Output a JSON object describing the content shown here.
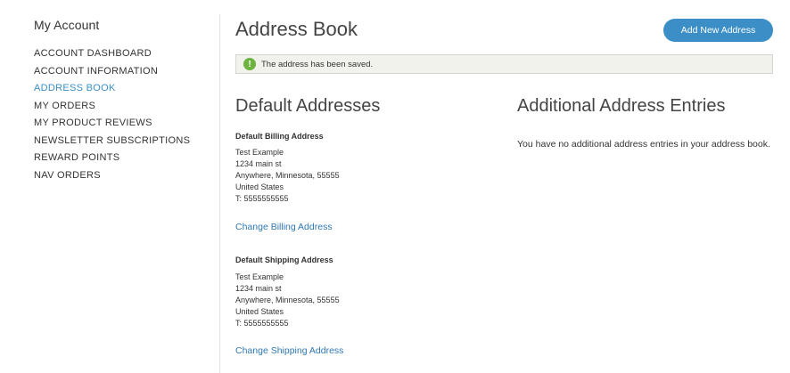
{
  "sidebar": {
    "title": "My Account",
    "items": [
      {
        "label": "ACCOUNT DASHBOARD"
      },
      {
        "label": "ACCOUNT INFORMATION"
      },
      {
        "label": "ADDRESS BOOK"
      },
      {
        "label": "MY ORDERS"
      },
      {
        "label": "MY PRODUCT REVIEWS"
      },
      {
        "label": "NEWSLETTER SUBSCRIPTIONS"
      },
      {
        "label": "REWARD POINTS"
      },
      {
        "label": "NAV ORDERS"
      }
    ]
  },
  "header": {
    "title": "Address Book",
    "add_button": "Add New Address"
  },
  "notice": {
    "icon": "!",
    "message": "The address has been saved."
  },
  "default_addresses": {
    "title": "Default Addresses",
    "billing": {
      "heading": "Default Billing Address",
      "lines": [
        "Test Example",
        "1234 main st",
        "Anywhere, Minnesota, 55555",
        "United States",
        "T: 5555555555"
      ],
      "link": "Change Billing Address"
    },
    "shipping": {
      "heading": "Default Shipping Address",
      "lines": [
        "Test Example",
        "1234 main st",
        "Anywhere, Minnesota, 55555",
        "United States",
        "T: 5555555555"
      ],
      "link": "Change Shipping Address"
    }
  },
  "additional": {
    "title": "Additional Address Entries",
    "message": "You have no additional address entries in your address book."
  },
  "colors": {
    "accent": "#3b8fc6",
    "link": "#2f78b5",
    "success": "#6cb33f"
  }
}
